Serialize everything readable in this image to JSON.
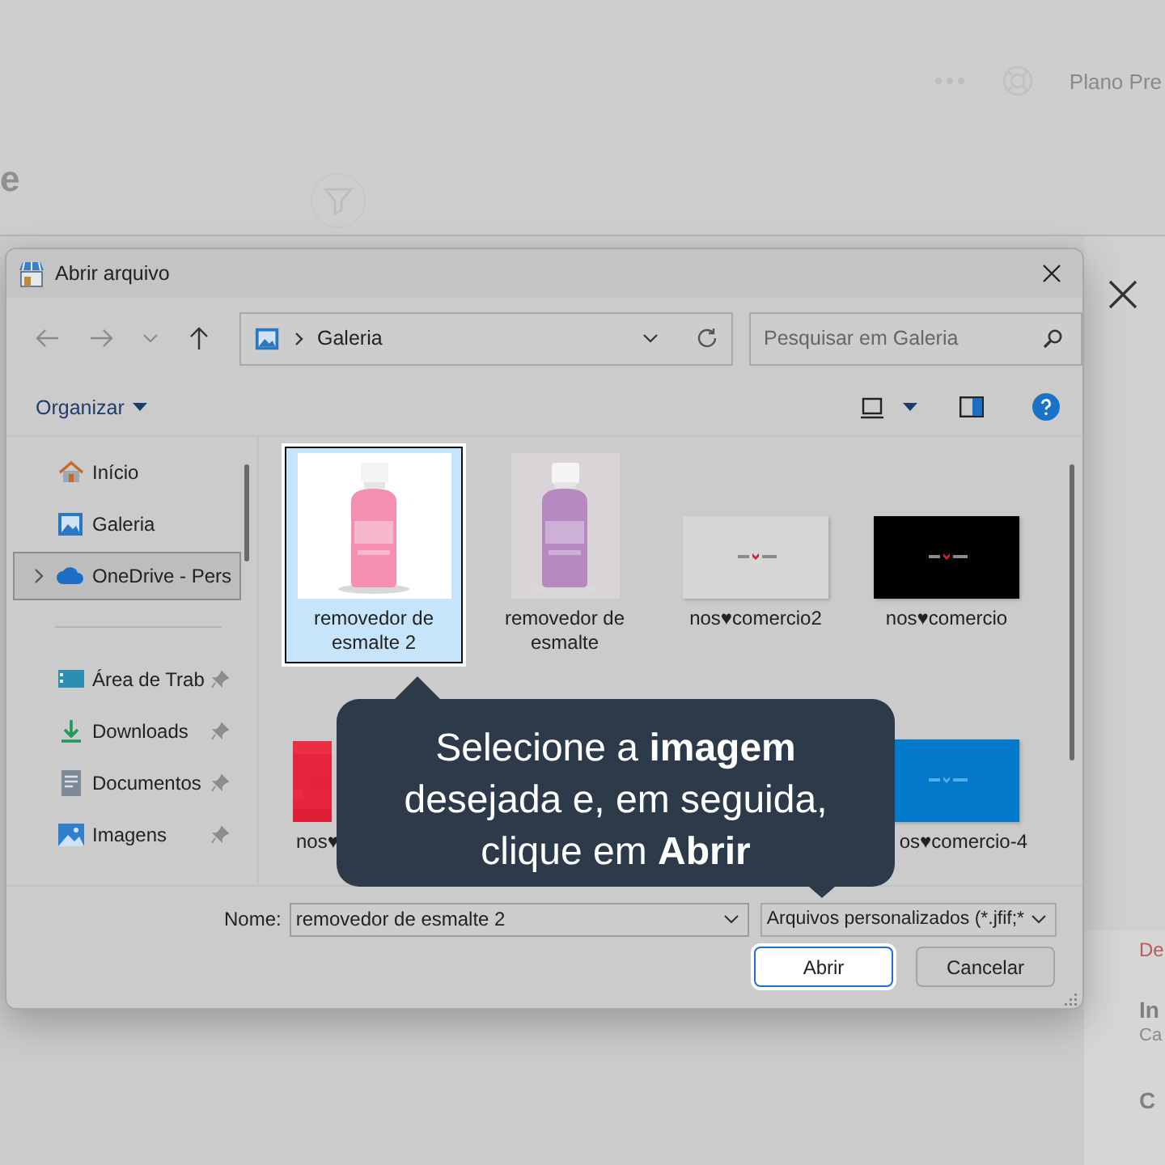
{
  "app": {
    "header_letter": "e",
    "plan_label": "Plano Pre",
    "side_fragments": [
      {
        "text": "De",
        "kind": "alert"
      },
      {
        "text": "In",
        "kind": "heading"
      },
      {
        "text": "Ca",
        "kind": "sub"
      },
      {
        "text": "C",
        "kind": "heading"
      }
    ]
  },
  "dialog": {
    "title": "Abrir arquivo",
    "breadcrumb": "Galeria",
    "search": {
      "placeholder": "Pesquisar em Galeria"
    },
    "organize": "Organizar",
    "sidebar": {
      "locations": [
        {
          "label": "Início",
          "kind": "home",
          "selected": false,
          "expandable": false
        },
        {
          "label": "Galeria",
          "kind": "gallery",
          "selected": false,
          "expandable": false
        },
        {
          "label": "OneDrive - Pers",
          "kind": "cloud",
          "selected": true,
          "expandable": true
        }
      ],
      "quick_access": [
        {
          "label": "Área de Trab",
          "kind": "desktop",
          "selected": false,
          "pinned": true
        },
        {
          "label": "Downloads",
          "kind": "download",
          "selected": false,
          "pinned": true
        },
        {
          "label": "Documentos",
          "kind": "document",
          "selected": false,
          "pinned": true
        },
        {
          "label": "Imagens",
          "kind": "pictures",
          "selected": false,
          "pinned": true
        }
      ]
    },
    "files": [
      {
        "label": "removedor de esmalte 2",
        "selected": true
      },
      {
        "label": "removedor de esmalte",
        "selected": false
      },
      {
        "label": "nos♥comercio2",
        "selected": false
      },
      {
        "label": "nos♥comercio",
        "selected": false
      }
    ],
    "files_row_2": [
      {
        "label": "nos♥",
        "selected": false
      },
      {
        "label": "os♥comercio-4",
        "selected": false
      }
    ],
    "file_name": {
      "label": "Nome:",
      "value": "removedor de esmalte 2"
    },
    "file_type": "Arquivos personalizados (*.jfif;*",
    "buttons": [
      {
        "label": "Abrir",
        "default": true
      },
      {
        "label": "Cancelar",
        "default": false
      }
    ]
  },
  "tooltip": {
    "text": "Selecione a **imagem** desejada e, em seguida, clique em **Abrir**"
  }
}
